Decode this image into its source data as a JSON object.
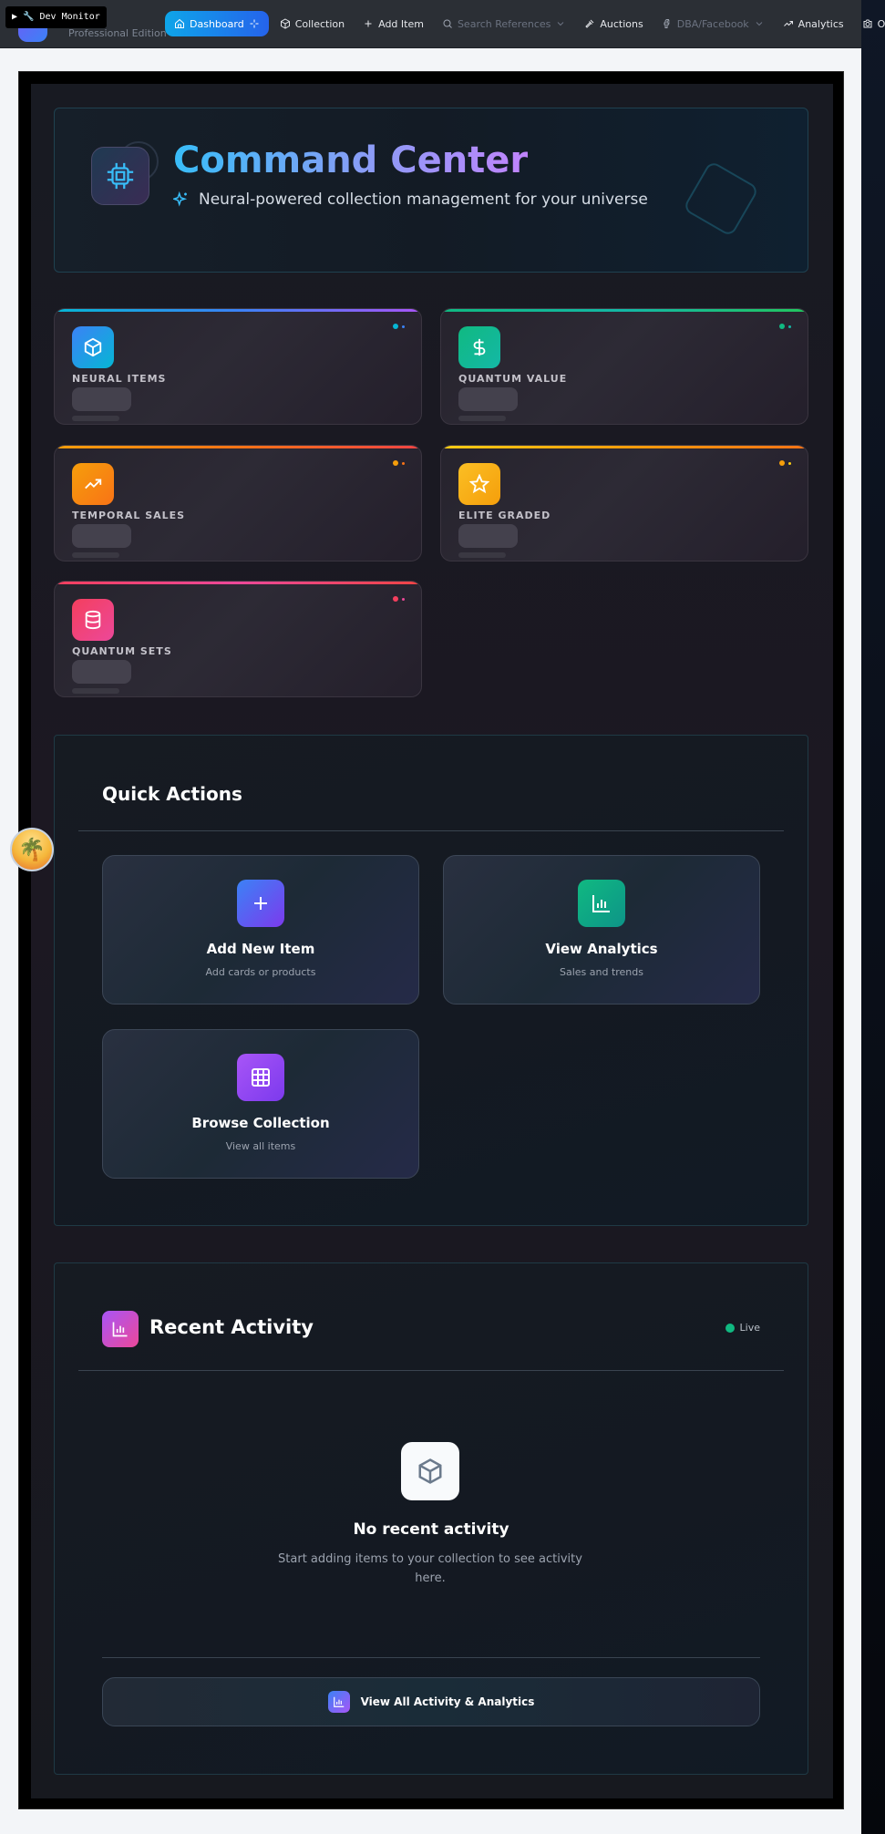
{
  "devtools": {
    "label": "▶ 🔧 Dev Monitor"
  },
  "brand": {
    "subtitle": "Professional Edition"
  },
  "nav": {
    "dashboard": "Dashboard",
    "collection": "Collection",
    "add_item": "Add Item",
    "search_references": "Search References",
    "auctions": "Auctions",
    "dba_facebook": "DBA/Facebook",
    "analytics": "Analytics",
    "ocr": "OCR"
  },
  "hero": {
    "title": "Command Center",
    "subtitle": "Neural-powered collection management for your universe"
  },
  "stats": [
    {
      "label": "NEURAL ITEMS",
      "icon": "box-icon",
      "color": "#0ea5e9"
    },
    {
      "label": "QUANTUM VALUE",
      "icon": "dollar-icon",
      "color": "#10b981"
    },
    {
      "label": "TEMPORAL SALES",
      "icon": "trending-up-icon",
      "color": "#f97316"
    },
    {
      "label": "ELITE GRADED",
      "icon": "star-icon",
      "color": "#f59e0b"
    },
    {
      "label": "QUANTUM SETS",
      "icon": "database-icon",
      "color": "#f43f5e"
    }
  ],
  "quick_actions": {
    "title": "Quick Actions",
    "items": [
      {
        "title": "Add New Item",
        "subtitle": "Add cards or products",
        "icon": "plus-icon"
      },
      {
        "title": "View Analytics",
        "subtitle": "Sales and trends",
        "icon": "bar-chart-icon"
      },
      {
        "title": "Browse Collection",
        "subtitle": "View all items",
        "icon": "grid-icon"
      }
    ]
  },
  "recent_activity": {
    "title": "Recent Activity",
    "live": "Live",
    "empty_title": "No recent activity",
    "empty_subtitle": "Start adding items to your collection to see activity here.",
    "view_all": "View All Activity & Analytics"
  }
}
